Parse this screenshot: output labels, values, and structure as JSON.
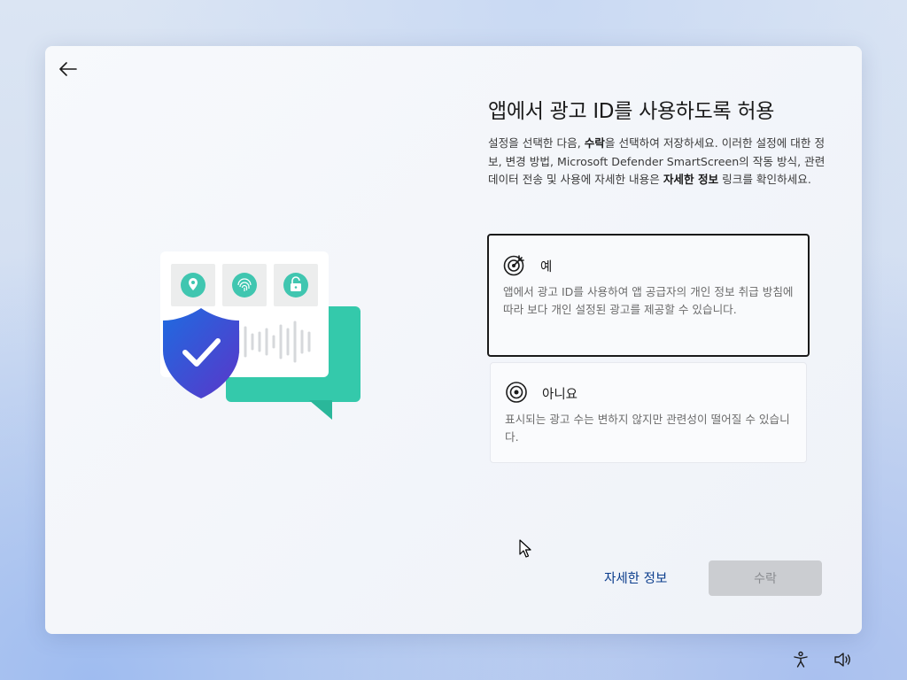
{
  "window": {
    "title": "앱에서 광고 ID를 사용하도록 허용",
    "description_parts": [
      "설정을 선택한 다음, ",
      "수락",
      "을 선택하여 저장하세요. 이러한 설정에 대한 정보, 변경 방법, Microsoft Defender SmartScreen의 작동 방식, 관련 데이터 전송 및 사용에 자세한 내용은 ",
      "자세한 정보",
      " 링크를 확인하세요."
    ]
  },
  "options": [
    {
      "label": "예",
      "description": "앱에서 광고 ID를 사용하여 앱 공급자의 개인 정보 취급 방침에 따라 보다 개인 설정된 광고를 제공할 수 있습니다.",
      "icon": "target-icon",
      "selected": true
    },
    {
      "label": "아니요",
      "description": "표시되는 광고 수는 변하지 않지만 관련성이 떨어질 수 있습니다.",
      "icon": "radio-target-icon",
      "selected": false
    }
  ],
  "footer": {
    "learn_more": "자세한 정보",
    "accept": "수락"
  },
  "colors": {
    "accent_link": "#0a3c8c",
    "shield_blue": "#2e5fe0",
    "teal": "#2ec4a6",
    "disabled_button": "#cbcdd1"
  },
  "tray": {
    "icons": [
      "accessibility-icon",
      "volume-icon"
    ]
  }
}
